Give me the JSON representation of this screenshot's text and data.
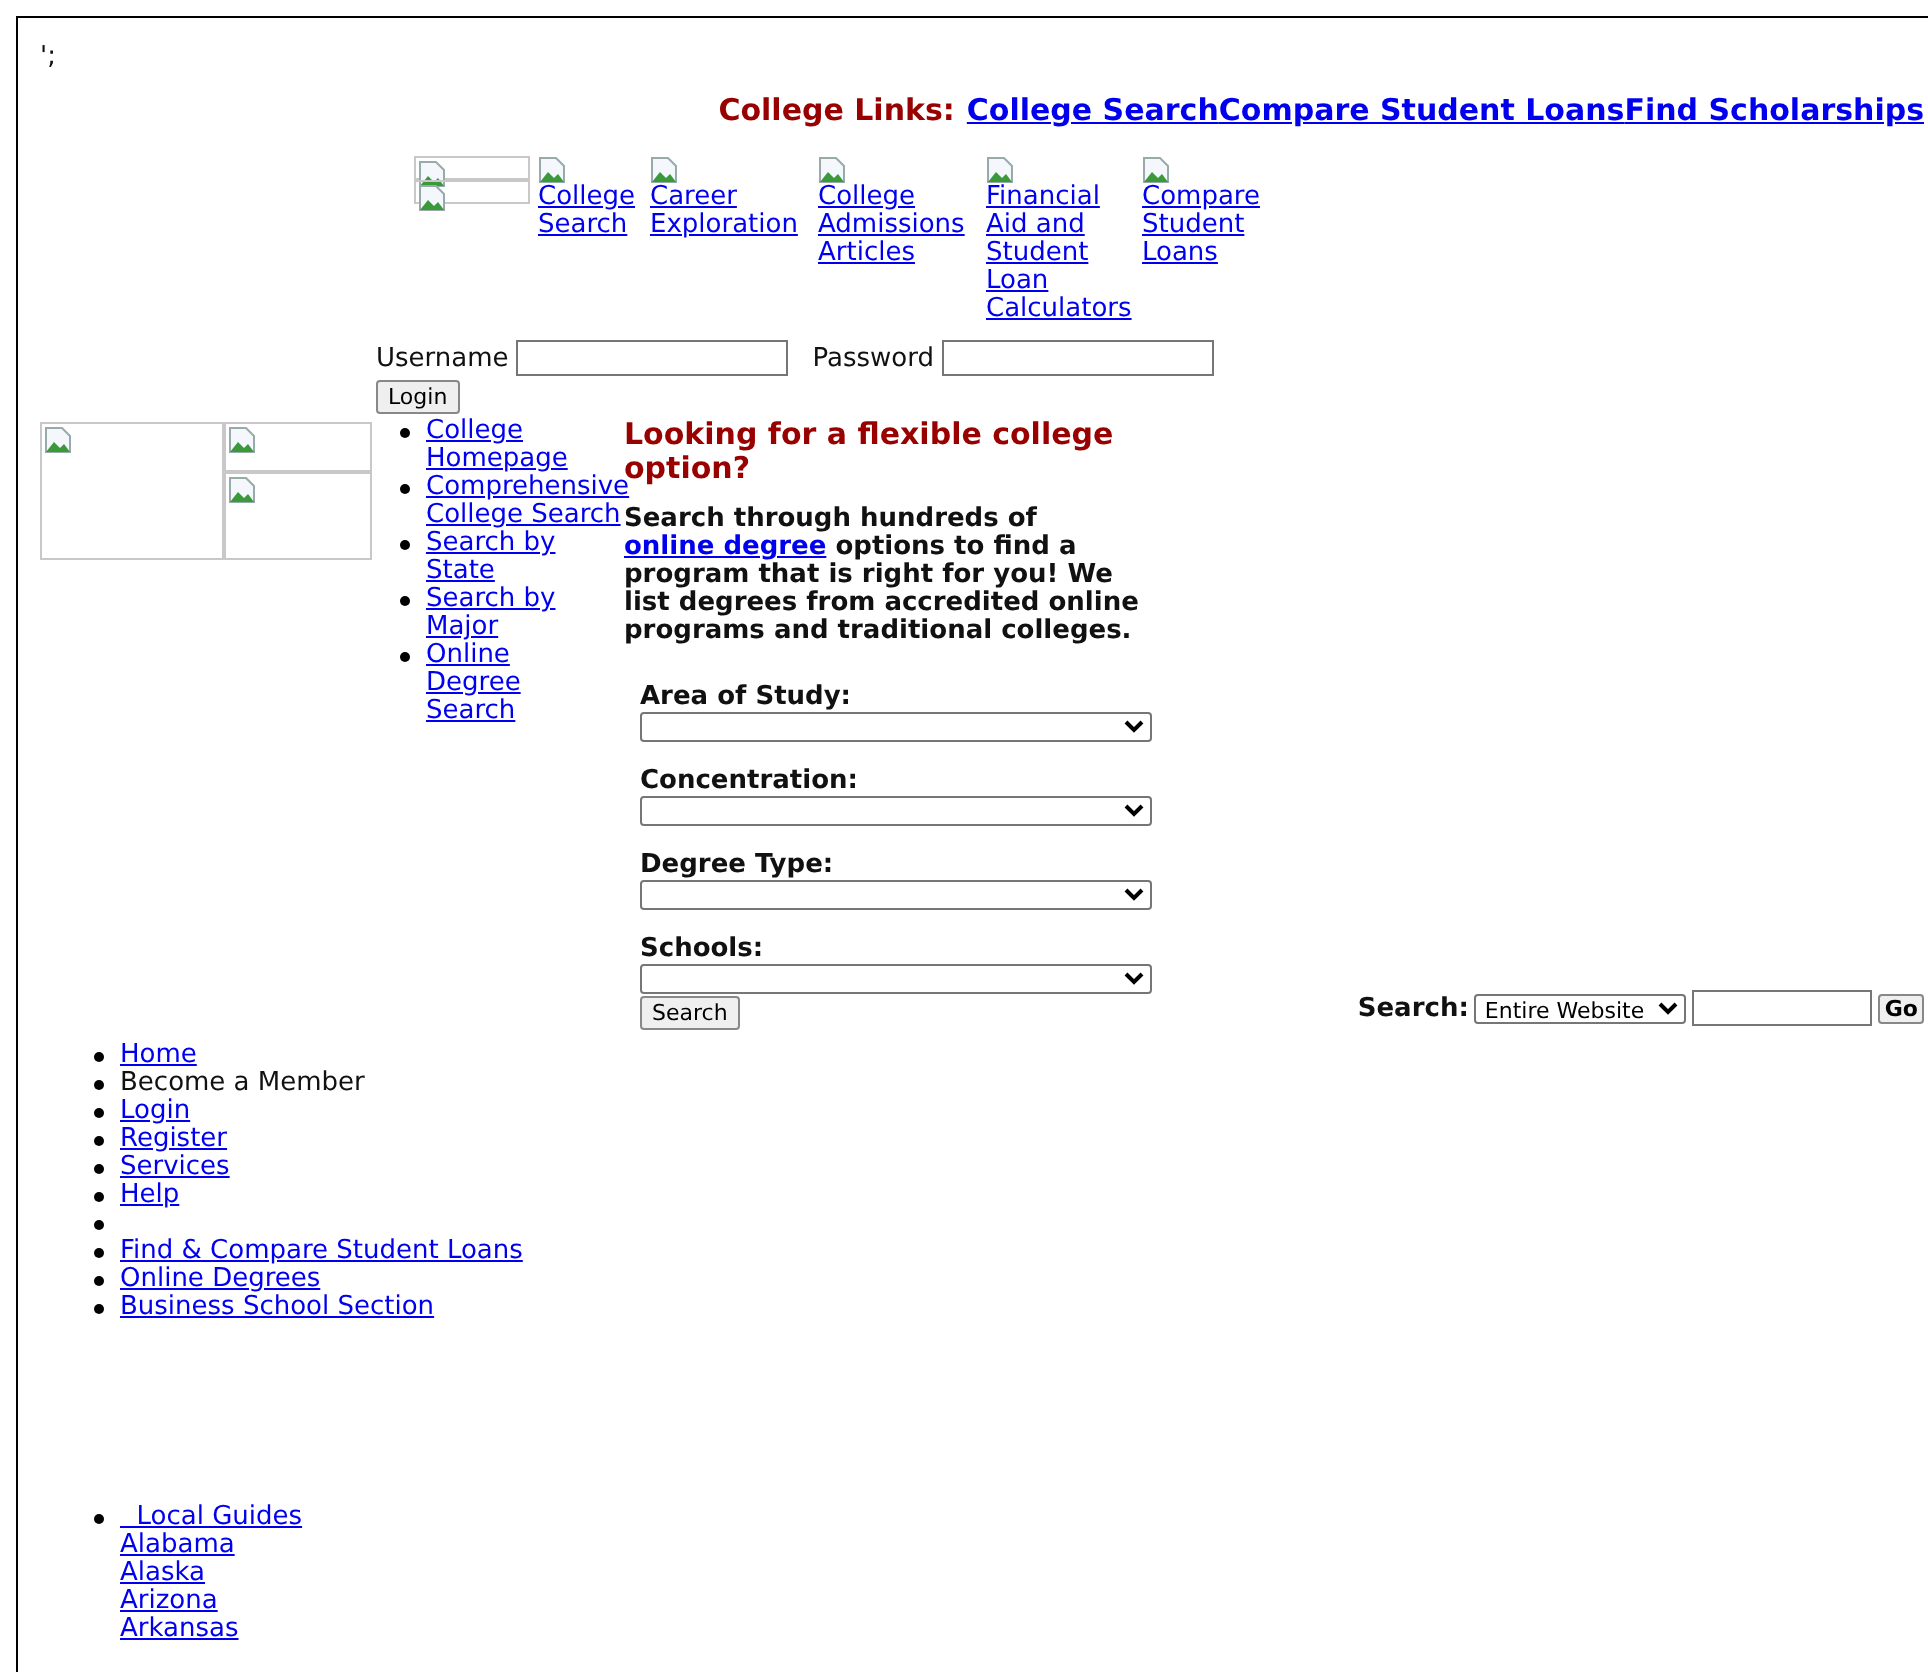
{
  "top_text": "';",
  "college_links": {
    "label": "College Links:",
    "links": [
      "College Search",
      "Compare Student Loans",
      "Find Scholarships"
    ]
  },
  "nav_links": [
    "College Search",
    "Career Exploration",
    "College Admissions Articles",
    "Financial Aid and Student Loan Calculators",
    "Compare Student Loans"
  ],
  "login": {
    "username_label": "Username",
    "password_label": "Password",
    "button": "Login"
  },
  "side_links": [
    "College Homepage",
    "Comprehensive College Search",
    "Search by State",
    "Search by Major",
    "Online Degree Search"
  ],
  "degree_search": {
    "heading": "Looking for a flexible college option?",
    "intro_before": "Search through hundreds of",
    "intro_link": "online degree",
    "intro_after": "options to find a program that is right for you! We list degrees from accredited online programs and traditional colleges.",
    "fields": [
      {
        "label": "Area of Study:"
      },
      {
        "label": "Concentration:"
      },
      {
        "label": "Degree Type:"
      },
      {
        "label": "Schools:"
      }
    ],
    "button": "Search"
  },
  "site_search": {
    "label": "Search:",
    "scope": "Entire Website",
    "button": "Go"
  },
  "footer_links": [
    {
      "kind": "link",
      "text": "Home"
    },
    {
      "kind": "text",
      "text": "Become a Member"
    },
    {
      "kind": "link",
      "text": "Login"
    },
    {
      "kind": "link",
      "text": "Register"
    },
    {
      "kind": "link",
      "text": "Services"
    },
    {
      "kind": "link",
      "text": "Help"
    },
    {
      "kind": "empty"
    },
    {
      "kind": "link",
      "text": "Find & Compare Student Loans"
    },
    {
      "kind": "link",
      "text": "Online Degrees"
    },
    {
      "kind": "link",
      "text": "Business School Section"
    }
  ],
  "local_guides": {
    "title": "  Local Guides",
    "states": [
      "Alabama",
      "Alaska",
      "Arizona",
      "Arkansas"
    ]
  }
}
